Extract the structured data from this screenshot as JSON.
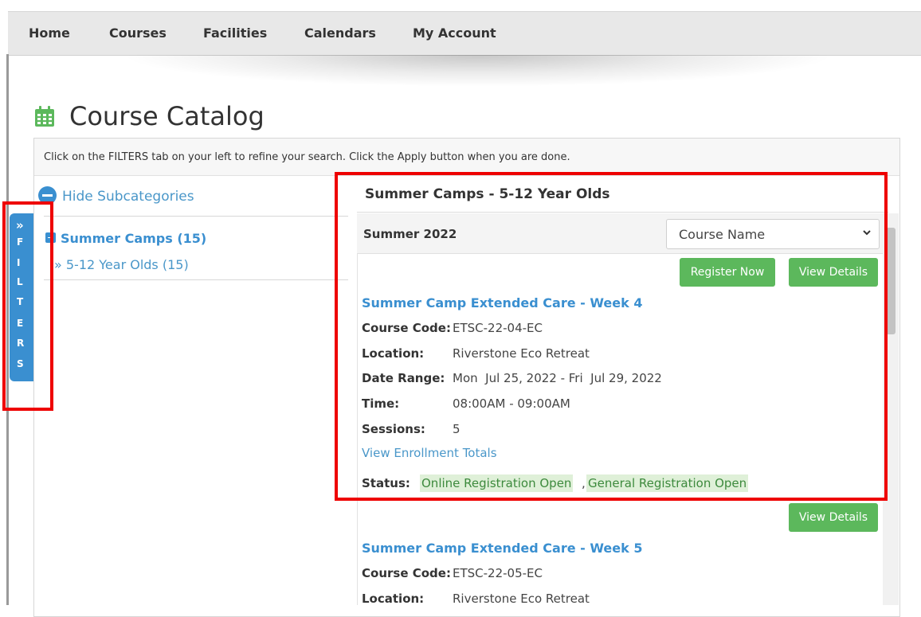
{
  "nav": {
    "items": [
      "Home",
      "Courses",
      "Facilities",
      "Calendars",
      "My Account"
    ]
  },
  "page": {
    "title": "Course Catalog",
    "title_icon": "calendar-icon"
  },
  "instructions": "Click on the FILTERS tab on your left to refine your search. Click the Apply button when you are done.",
  "filters_tab": {
    "letters": [
      "F",
      "I",
      "L",
      "T",
      "E",
      "R",
      "S"
    ],
    "chevron": "»"
  },
  "sidebar": {
    "hide_label": "Hide Subcategories",
    "category": "Summer Camps (15)",
    "subcategory": "» 5-12 Year Olds (15)"
  },
  "results": {
    "category_header": "Summer Camps - 5-12 Year Olds",
    "term": "Summer 2022",
    "sort": {
      "selected": "Course Name"
    },
    "courses": [
      {
        "register_label": "Register Now",
        "details_label": "View Details",
        "name": "Summer Camp Extended Care - Week 4",
        "code_label": "Course Code:",
        "code": "ETSC-22-04-EC",
        "location_label": "Location:",
        "location": "Riverstone Eco Retreat",
        "date_label": "Date Range:",
        "date_range": "Mon  Jul 25, 2022 - Fri  Jul 29, 2022",
        "time_label": "Time:",
        "time": "08:00AM - 09:00AM",
        "sessions_label": "Sessions:",
        "sessions": "5",
        "enrollment_link": "View Enrollment Totals",
        "status_label": "Status:",
        "status": [
          "Online Registration Open",
          "General Registration Open"
        ]
      },
      {
        "details_label": "View Details",
        "name": "Summer Camp Extended Care - Week 5",
        "code_label": "Course Code:",
        "code": "ETSC-22-05-EC",
        "location_label": "Location:",
        "location": "Riverstone Eco Retreat"
      }
    ]
  },
  "colors": {
    "accent": "#3a8fd0",
    "button": "#5cb85c",
    "highlight": "#ee0000",
    "status_bg": "#dff0d8"
  }
}
